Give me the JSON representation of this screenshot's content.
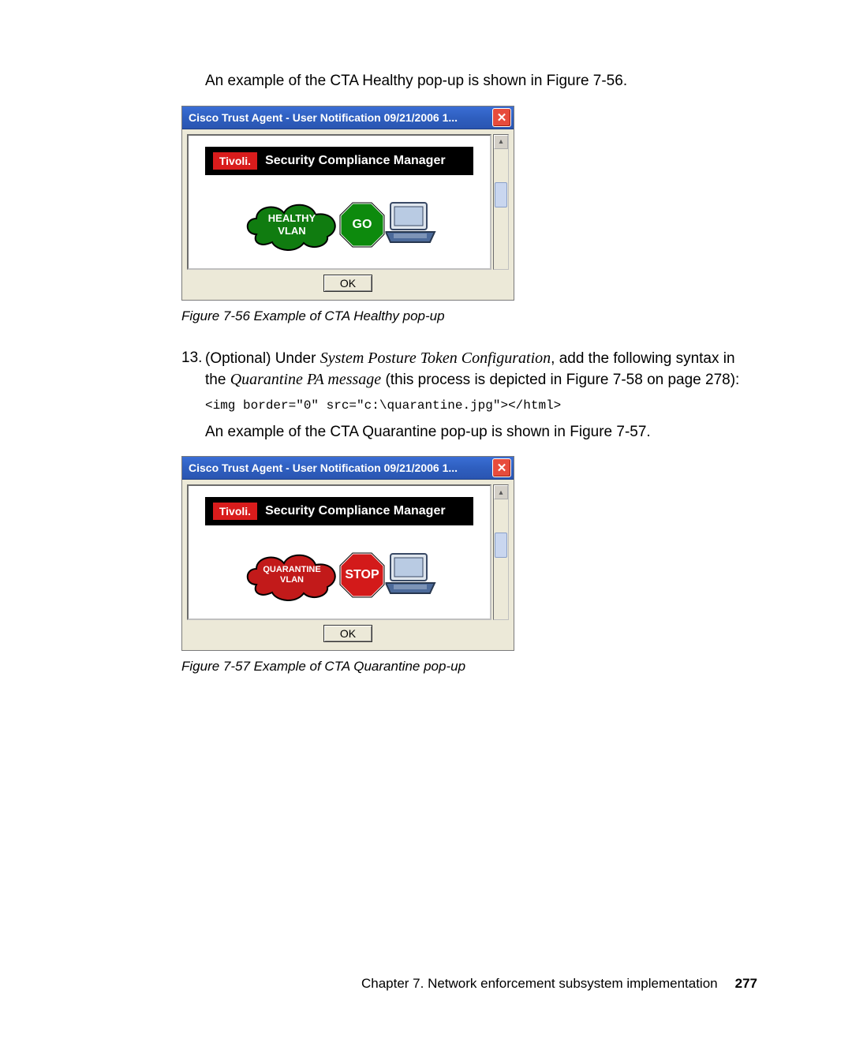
{
  "intro1": "An example of the CTA Healthy pop-up is shown in Figure 7-56.",
  "fig56": {
    "caption": "Figure 7-56   Example of CTA Healthy pop-up",
    "titlebar": "Cisco Trust Agent - User Notification 09/21/2006 1...",
    "close": "✕",
    "tivoli_tag": "Tivoli.",
    "tivoli_text": "Security Compliance Manager",
    "cloud_text": "HEALTHY\nVLAN",
    "sign_text": "GO",
    "ok": "OK",
    "colors": {
      "cloud": "#107c10",
      "sign_fill": "#0d8a0d",
      "sign_border": "#ffffff"
    }
  },
  "step13": {
    "num": "13.",
    "text_pre": "(Optional) Under ",
    "em1": "System Posture Token Configuration",
    "text_mid": ", add the following syntax in the ",
    "em2": "Quarantine PA message",
    "text_post": " (this process is depicted in Figure 7-58 on page 278):"
  },
  "code_line": "<img border=\"0\" src=\"c:\\quarantine.jpg\"></html>",
  "intro2": "An example of the CTA Quarantine pop-up is shown in Figure 7-57.",
  "fig57": {
    "caption": "Figure 7-57   Example of CTA Quarantine pop-up",
    "titlebar": "Cisco Trust Agent - User Notification 09/21/2006 1...",
    "close": "✕",
    "tivoli_tag": "Tivoli.",
    "tivoli_text": "Security Compliance Manager",
    "cloud_text": "QUARANTINE\nVLAN",
    "sign_text": "STOP",
    "ok": "OK",
    "colors": {
      "cloud": "#c21a1a",
      "sign_fill": "#d31a1a",
      "sign_border": "#ffffff"
    }
  },
  "footer": {
    "chapter": "Chapter 7. Network enforcement subsystem implementation",
    "page": "277"
  }
}
